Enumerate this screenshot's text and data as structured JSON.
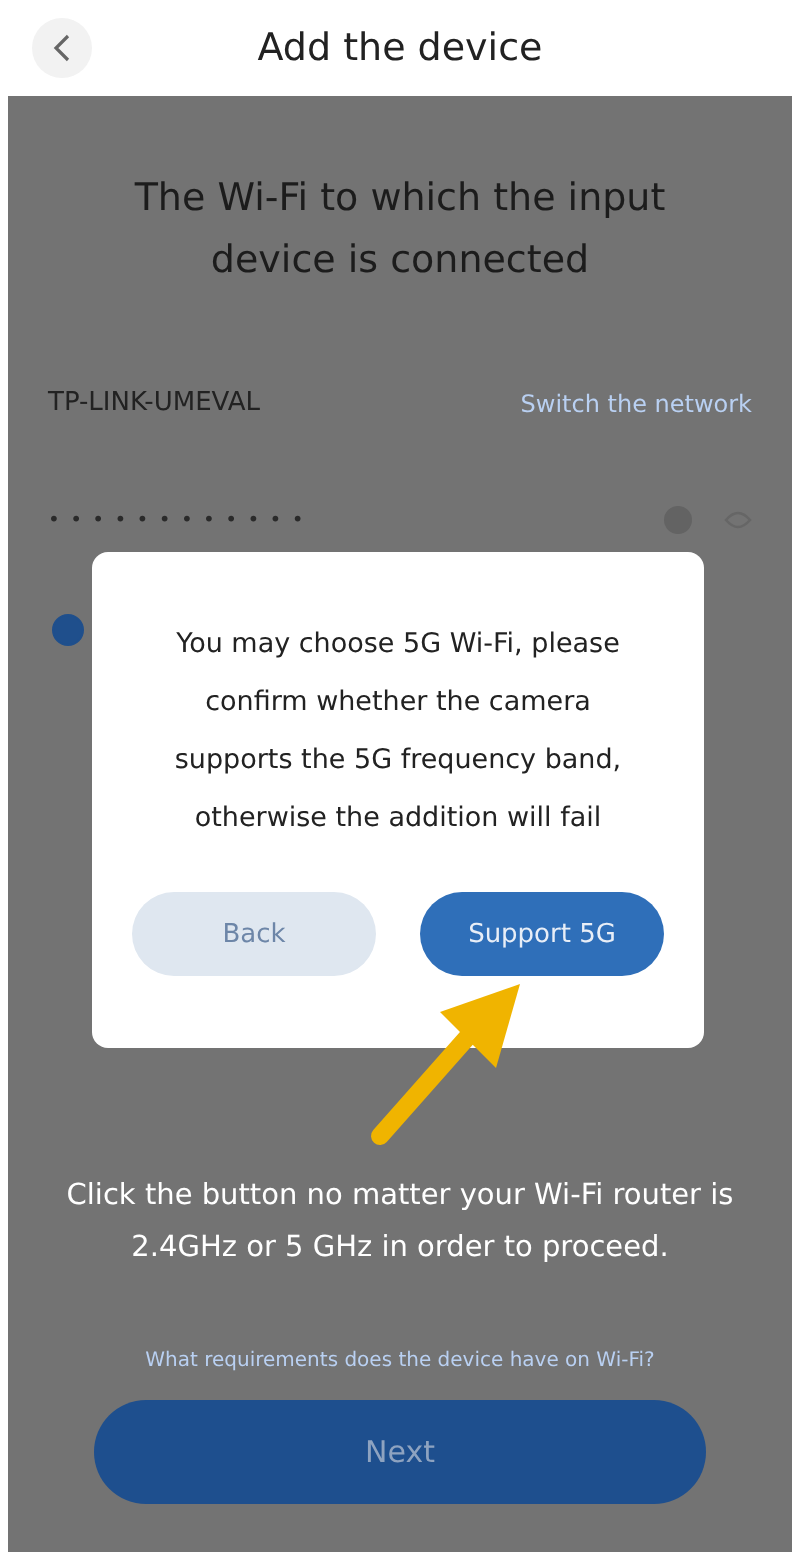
{
  "header": {
    "title": "Add the device"
  },
  "heading": "The Wi-Fi to which the input device is connected",
  "network": {
    "name": "TP-LINK-UMEVAL",
    "switch_link": "Switch the network"
  },
  "password": {
    "value": "• • • • • • • • • • • •"
  },
  "agreement": {
    "checked": true
  },
  "note": "Click the button no matter your Wi-Fi router is 2.4GHz or 5 GHz in order to proceed.",
  "help_link": "What requirements does the device have on Wi-Fi?",
  "next_button": "Next",
  "dialog": {
    "message": "You may choose 5G Wi-Fi, please confirm whether the camera supports the 5G frequency band, otherwise the addition will fail",
    "buttons": [
      {
        "label": "Back",
        "kind": "secondary"
      },
      {
        "label": "Support 5G",
        "kind": "primary"
      }
    ]
  }
}
